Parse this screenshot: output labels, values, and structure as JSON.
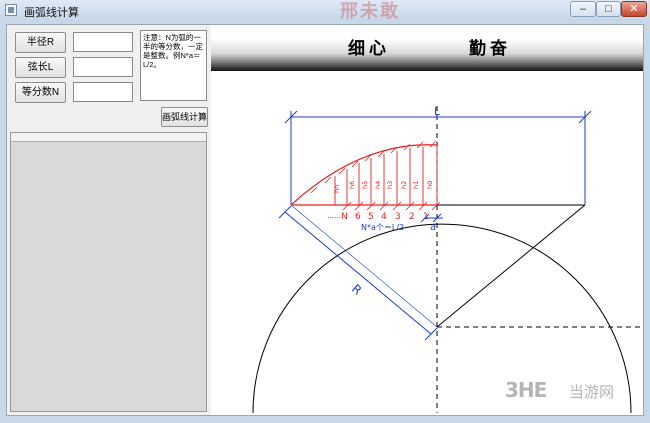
{
  "window": {
    "title": "画弧线计算",
    "watermark_top": "邢未敢"
  },
  "window_buttons": {
    "min": "–",
    "max": "□",
    "close": "✕"
  },
  "form": {
    "radius_label": "半径R",
    "chord_label": "弦长L",
    "divisions_label": "等分数N",
    "radius_value": "",
    "chord_value": "",
    "divisions_value": "",
    "note": "注意：N为弧的一半的等分数，一定是整数。例N*a＝L/2。",
    "calc_button": "画弧线计算"
  },
  "banner": {
    "left": "细心",
    "right": "勤奋"
  },
  "diagram": {
    "L_label": "L",
    "R_label": "R",
    "a_label": "a",
    "formula": "N*a个＝L/2",
    "h_labels": [
      "hn",
      "h6",
      "h5",
      "h4",
      "h3",
      "h2",
      "h1",
      "h0"
    ],
    "n_labels": [
      "N",
      "6",
      "5",
      "4",
      "3",
      "2",
      "1"
    ],
    "ellipsis": "……"
  },
  "watermark": {
    "logo": "3HE",
    "name": "当游网"
  }
}
